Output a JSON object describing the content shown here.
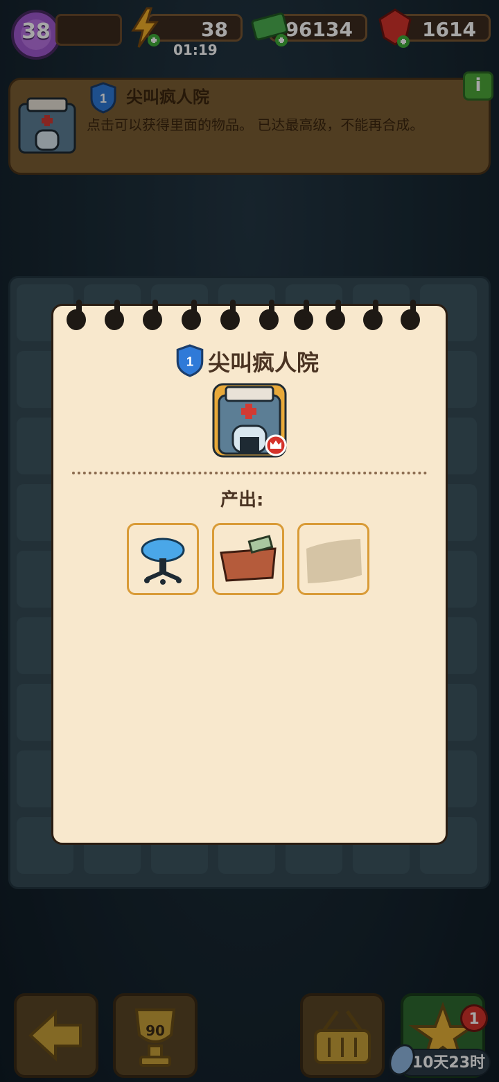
{
  "hud": {
    "level": "38",
    "energy": "38",
    "energy_timer": "01:19",
    "cash": "96134",
    "gems": "1614"
  },
  "banner": {
    "level": "1",
    "title": "尖叫疯人院",
    "description": "点击可以获得里面的物品。 已达最高级，不能再合成。",
    "info_label": "i"
  },
  "popup": {
    "level": "1",
    "title": "尖叫疯人院",
    "output_label": "产出:",
    "outputs": [
      {
        "icon": "stool-icon"
      },
      {
        "icon": "cash-box-icon"
      },
      {
        "icon": "locked-item-icon"
      }
    ]
  },
  "bottom_bar": {
    "trophy_count": "90",
    "notification_count": "1",
    "event_timer": "10天23时"
  },
  "colors": {
    "popup_bg": "#f8e8cd",
    "slot_border": "#d99b37",
    "shield_blue": "#2f7ad8",
    "crown_red": "#d5332b"
  }
}
